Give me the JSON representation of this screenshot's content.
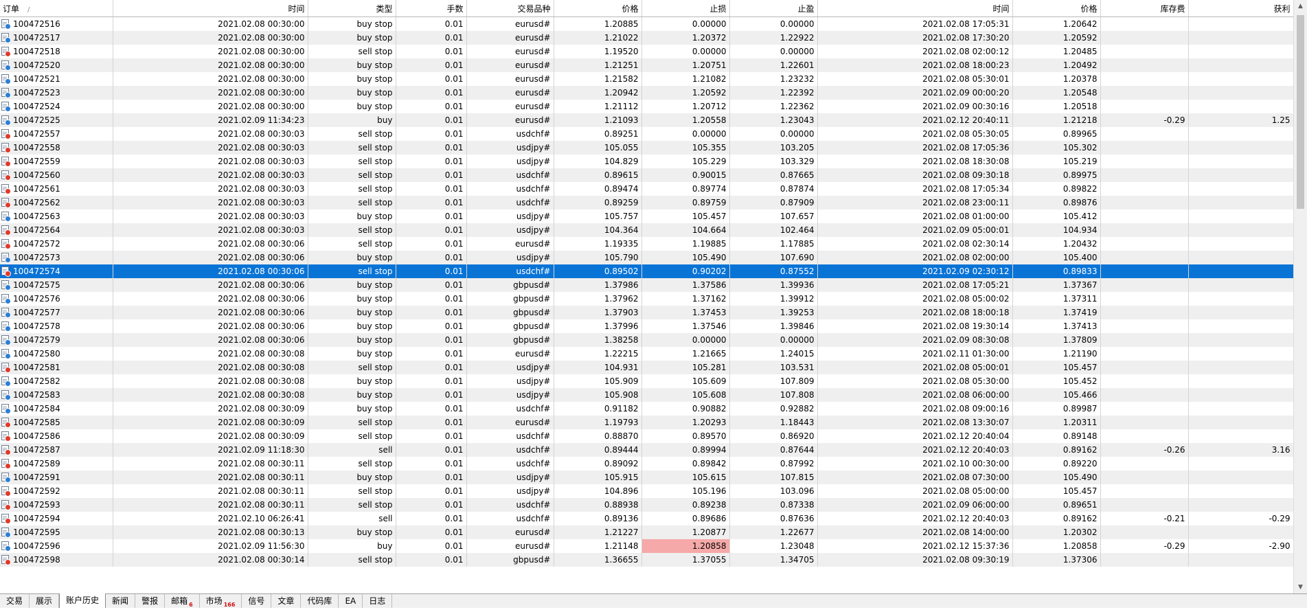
{
  "columns": [
    "订单",
    "时间",
    "类型",
    "手数",
    "交易品种",
    "价格",
    "止损",
    "止盈",
    "时间",
    "价格",
    "库存费",
    "获利"
  ],
  "sort_indicator": "/",
  "selected_row": 18,
  "rows": [
    {
      "icon": "blue",
      "cells": [
        "100472516",
        "2021.02.08 00:30:00",
        "buy stop",
        "0.01",
        "eurusd#",
        "1.20885",
        "0.00000",
        "0.00000",
        "2021.02.08 17:05:31",
        "1.20642",
        "",
        ""
      ]
    },
    {
      "icon": "blue",
      "cells": [
        "100472517",
        "2021.02.08 00:30:00",
        "buy stop",
        "0.01",
        "eurusd#",
        "1.21022",
        "1.20372",
        "1.22922",
        "2021.02.08 17:30:20",
        "1.20592",
        "",
        ""
      ]
    },
    {
      "icon": "red",
      "cells": [
        "100472518",
        "2021.02.08 00:30:00",
        "sell stop",
        "0.01",
        "eurusd#",
        "1.19520",
        "0.00000",
        "0.00000",
        "2021.02.08 02:00:12",
        "1.20485",
        "",
        ""
      ]
    },
    {
      "icon": "blue",
      "cells": [
        "100472520",
        "2021.02.08 00:30:00",
        "buy stop",
        "0.01",
        "eurusd#",
        "1.21251",
        "1.20751",
        "1.22601",
        "2021.02.08 18:00:23",
        "1.20492",
        "",
        ""
      ]
    },
    {
      "icon": "blue",
      "cells": [
        "100472521",
        "2021.02.08 00:30:00",
        "buy stop",
        "0.01",
        "eurusd#",
        "1.21582",
        "1.21082",
        "1.23232",
        "2021.02.08 05:30:01",
        "1.20378",
        "",
        ""
      ]
    },
    {
      "icon": "blue",
      "cells": [
        "100472523",
        "2021.02.08 00:30:00",
        "buy stop",
        "0.01",
        "eurusd#",
        "1.20942",
        "1.20592",
        "1.22392",
        "2021.02.09 00:00:20",
        "1.20548",
        "",
        ""
      ]
    },
    {
      "icon": "blue",
      "cells": [
        "100472524",
        "2021.02.08 00:30:00",
        "buy stop",
        "0.01",
        "eurusd#",
        "1.21112",
        "1.20712",
        "1.22362",
        "2021.02.09 00:30:16",
        "1.20518",
        "",
        ""
      ]
    },
    {
      "icon": "blue",
      "cells": [
        "100472525",
        "2021.02.09 11:34:23",
        "buy",
        "0.01",
        "eurusd#",
        "1.21093",
        "1.20558",
        "1.23043",
        "2021.02.12 20:40:11",
        "1.21218",
        "-0.29",
        "1.25"
      ]
    },
    {
      "icon": "red",
      "cells": [
        "100472557",
        "2021.02.08 00:30:03",
        "sell stop",
        "0.01",
        "usdchf#",
        "0.89251",
        "0.00000",
        "0.00000",
        "2021.02.08 05:30:05",
        "0.89965",
        "",
        ""
      ]
    },
    {
      "icon": "red",
      "cells": [
        "100472558",
        "2021.02.08 00:30:03",
        "sell stop",
        "0.01",
        "usdjpy#",
        "105.055",
        "105.355",
        "103.205",
        "2021.02.08 17:05:36",
        "105.302",
        "",
        ""
      ]
    },
    {
      "icon": "red",
      "cells": [
        "100472559",
        "2021.02.08 00:30:03",
        "sell stop",
        "0.01",
        "usdjpy#",
        "104.829",
        "105.229",
        "103.329",
        "2021.02.08 18:30:08",
        "105.219",
        "",
        ""
      ]
    },
    {
      "icon": "red",
      "cells": [
        "100472560",
        "2021.02.08 00:30:03",
        "sell stop",
        "0.01",
        "usdchf#",
        "0.89615",
        "0.90015",
        "0.87665",
        "2021.02.08 09:30:18",
        "0.89975",
        "",
        ""
      ]
    },
    {
      "icon": "red",
      "cells": [
        "100472561",
        "2021.02.08 00:30:03",
        "sell stop",
        "0.01",
        "usdchf#",
        "0.89474",
        "0.89774",
        "0.87874",
        "2021.02.08 17:05:34",
        "0.89822",
        "",
        ""
      ]
    },
    {
      "icon": "red",
      "cells": [
        "100472562",
        "2021.02.08 00:30:03",
        "sell stop",
        "0.01",
        "usdchf#",
        "0.89259",
        "0.89759",
        "0.87909",
        "2021.02.08 23:00:11",
        "0.89876",
        "",
        ""
      ]
    },
    {
      "icon": "blue",
      "cells": [
        "100472563",
        "2021.02.08 00:30:03",
        "buy stop",
        "0.01",
        "usdjpy#",
        "105.757",
        "105.457",
        "107.657",
        "2021.02.08 01:00:00",
        "105.412",
        "",
        ""
      ]
    },
    {
      "icon": "red",
      "cells": [
        "100472564",
        "2021.02.08 00:30:03",
        "sell stop",
        "0.01",
        "usdjpy#",
        "104.364",
        "104.664",
        "102.464",
        "2021.02.09 05:00:01",
        "104.934",
        "",
        ""
      ]
    },
    {
      "icon": "red",
      "cells": [
        "100472572",
        "2021.02.08 00:30:06",
        "sell stop",
        "0.01",
        "eurusd#",
        "1.19335",
        "1.19885",
        "1.17885",
        "2021.02.08 02:30:14",
        "1.20432",
        "",
        ""
      ]
    },
    {
      "icon": "blue",
      "cells": [
        "100472573",
        "2021.02.08 00:30:06",
        "buy stop",
        "0.01",
        "usdjpy#",
        "105.790",
        "105.490",
        "107.690",
        "2021.02.08 02:00:00",
        "105.400",
        "",
        ""
      ]
    },
    {
      "icon": "red",
      "cells": [
        "100472574",
        "2021.02.08 00:30:06",
        "sell stop",
        "0.01",
        "usdchf#",
        "0.89502",
        "0.90202",
        "0.87552",
        "2021.02.09 02:30:12",
        "0.89833",
        "",
        ""
      ]
    },
    {
      "icon": "blue",
      "cells": [
        "100472575",
        "2021.02.08 00:30:06",
        "buy stop",
        "0.01",
        "gbpusd#",
        "1.37986",
        "1.37586",
        "1.39936",
        "2021.02.08 17:05:21",
        "1.37367",
        "",
        ""
      ]
    },
    {
      "icon": "blue",
      "cells": [
        "100472576",
        "2021.02.08 00:30:06",
        "buy stop",
        "0.01",
        "gbpusd#",
        "1.37962",
        "1.37162",
        "1.39912",
        "2021.02.08 05:00:02",
        "1.37311",
        "",
        ""
      ]
    },
    {
      "icon": "blue",
      "cells": [
        "100472577",
        "2021.02.08 00:30:06",
        "buy stop",
        "0.01",
        "gbpusd#",
        "1.37903",
        "1.37453",
        "1.39253",
        "2021.02.08 18:00:18",
        "1.37419",
        "",
        ""
      ]
    },
    {
      "icon": "blue",
      "cells": [
        "100472578",
        "2021.02.08 00:30:06",
        "buy stop",
        "0.01",
        "gbpusd#",
        "1.37996",
        "1.37546",
        "1.39846",
        "2021.02.08 19:30:14",
        "1.37413",
        "",
        ""
      ]
    },
    {
      "icon": "blue",
      "cells": [
        "100472579",
        "2021.02.08 00:30:06",
        "buy stop",
        "0.01",
        "gbpusd#",
        "1.38258",
        "0.00000",
        "0.00000",
        "2021.02.09 08:30:08",
        "1.37809",
        "",
        ""
      ]
    },
    {
      "icon": "blue",
      "cells": [
        "100472580",
        "2021.02.08 00:30:08",
        "buy stop",
        "0.01",
        "eurusd#",
        "1.22215",
        "1.21665",
        "1.24015",
        "2021.02.11 01:30:00",
        "1.21190",
        "",
        ""
      ]
    },
    {
      "icon": "red",
      "cells": [
        "100472581",
        "2021.02.08 00:30:08",
        "sell stop",
        "0.01",
        "usdjpy#",
        "104.931",
        "105.281",
        "103.531",
        "2021.02.08 05:00:01",
        "105.457",
        "",
        ""
      ]
    },
    {
      "icon": "blue",
      "cells": [
        "100472582",
        "2021.02.08 00:30:08",
        "buy stop",
        "0.01",
        "usdjpy#",
        "105.909",
        "105.609",
        "107.809",
        "2021.02.08 05:30:00",
        "105.452",
        "",
        ""
      ]
    },
    {
      "icon": "blue",
      "cells": [
        "100472583",
        "2021.02.08 00:30:08",
        "buy stop",
        "0.01",
        "usdjpy#",
        "105.908",
        "105.608",
        "107.808",
        "2021.02.08 06:00:00",
        "105.466",
        "",
        ""
      ]
    },
    {
      "icon": "blue",
      "cells": [
        "100472584",
        "2021.02.08 00:30:09",
        "buy stop",
        "0.01",
        "usdchf#",
        "0.91182",
        "0.90882",
        "0.92882",
        "2021.02.08 09:00:16",
        "0.89987",
        "",
        ""
      ]
    },
    {
      "icon": "red",
      "cells": [
        "100472585",
        "2021.02.08 00:30:09",
        "sell stop",
        "0.01",
        "eurusd#",
        "1.19793",
        "1.20293",
        "1.18443",
        "2021.02.08 13:30:07",
        "1.20311",
        "",
        ""
      ]
    },
    {
      "icon": "red",
      "cells": [
        "100472586",
        "2021.02.08 00:30:09",
        "sell stop",
        "0.01",
        "usdchf#",
        "0.88870",
        "0.89570",
        "0.86920",
        "2021.02.12 20:40:04",
        "0.89148",
        "",
        ""
      ]
    },
    {
      "icon": "red",
      "cells": [
        "100472587",
        "2021.02.09 11:18:30",
        "sell",
        "0.01",
        "usdchf#",
        "0.89444",
        "0.89994",
        "0.87644",
        "2021.02.12 20:40:03",
        "0.89162",
        "-0.26",
        "3.16"
      ]
    },
    {
      "icon": "red",
      "cells": [
        "100472589",
        "2021.02.08 00:30:11",
        "sell stop",
        "0.01",
        "usdchf#",
        "0.89092",
        "0.89842",
        "0.87992",
        "2021.02.10 00:30:00",
        "0.89220",
        "",
        ""
      ]
    },
    {
      "icon": "blue",
      "cells": [
        "100472591",
        "2021.02.08 00:30:11",
        "buy stop",
        "0.01",
        "usdjpy#",
        "105.915",
        "105.615",
        "107.815",
        "2021.02.08 07:30:00",
        "105.490",
        "",
        ""
      ]
    },
    {
      "icon": "red",
      "cells": [
        "100472592",
        "2021.02.08 00:30:11",
        "sell stop",
        "0.01",
        "usdjpy#",
        "104.896",
        "105.196",
        "103.096",
        "2021.02.08 05:00:00",
        "105.457",
        "",
        ""
      ]
    },
    {
      "icon": "red",
      "cells": [
        "100472593",
        "2021.02.08 00:30:11",
        "sell stop",
        "0.01",
        "usdchf#",
        "0.88938",
        "0.89238",
        "0.87338",
        "2021.02.09 06:00:00",
        "0.89651",
        "",
        ""
      ]
    },
    {
      "icon": "red",
      "cells": [
        "100472594",
        "2021.02.10 06:26:41",
        "sell",
        "0.01",
        "usdchf#",
        "0.89136",
        "0.89686",
        "0.87636",
        "2021.02.12 20:40:03",
        "0.89162",
        "-0.21",
        "-0.29"
      ]
    },
    {
      "icon": "blue",
      "cells": [
        "100472595",
        "2021.02.08 00:30:13",
        "buy stop",
        "0.01",
        "eurusd#",
        "1.21227",
        "1.20877",
        "1.22677",
        "2021.02.08 14:00:00",
        "1.20302",
        "",
        ""
      ]
    },
    {
      "icon": "blue",
      "cells": [
        "100472596",
        "2021.02.09 11:56:30",
        "buy",
        "0.01",
        "eurusd#",
        "1.21148",
        "1.20858",
        "1.23048",
        "2021.02.12 15:37:36",
        "1.20858",
        "-0.29",
        "-2.90"
      ],
      "hit_sl": true
    },
    {
      "icon": "red",
      "cells": [
        "100472598",
        "2021.02.08 00:30:14",
        "sell stop",
        "0.01",
        "gbpusd#",
        "1.36655",
        "1.37055",
        "1.34705",
        "2021.02.08 09:30:19",
        "1.37306",
        "",
        ""
      ]
    }
  ],
  "tabs": [
    {
      "label": "交易",
      "badge": ""
    },
    {
      "label": "展示",
      "badge": ""
    },
    {
      "label": "账户历史",
      "badge": "",
      "active": true
    },
    {
      "label": "新闻",
      "badge": ""
    },
    {
      "label": "警报",
      "badge": ""
    },
    {
      "label": "邮箱",
      "badge": "6"
    },
    {
      "label": "市场",
      "badge": "166"
    },
    {
      "label": "信号",
      "badge": ""
    },
    {
      "label": "文章",
      "badge": ""
    },
    {
      "label": "代码库",
      "badge": ""
    },
    {
      "label": "EA",
      "badge": ""
    },
    {
      "label": "日志",
      "badge": ""
    }
  ],
  "colors": {
    "selection": "#0a74d6",
    "stop_loss_hit": "#f5a9a9",
    "alt_row": "#efefef"
  }
}
